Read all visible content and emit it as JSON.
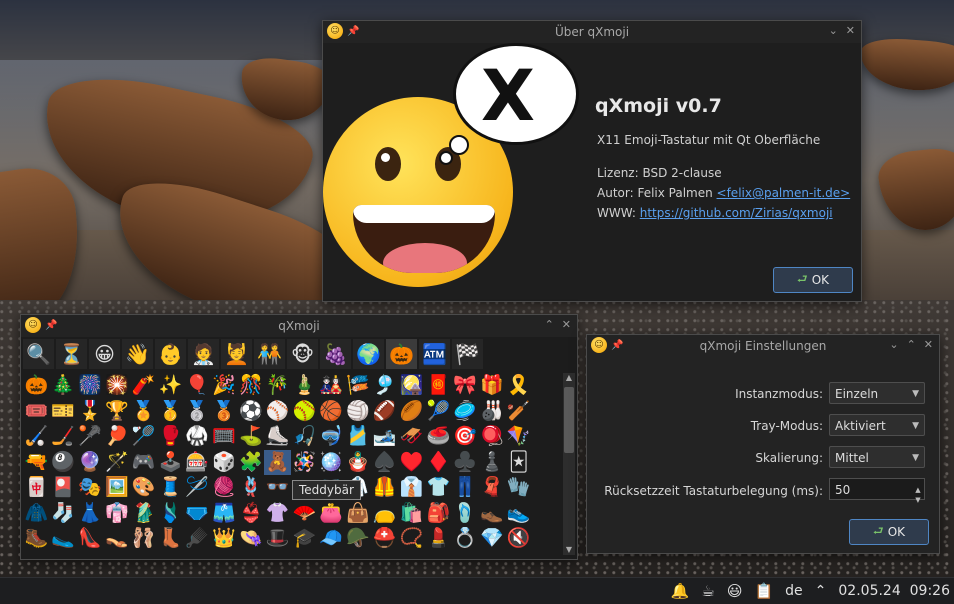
{
  "about": {
    "window_title": "Über qXmoji",
    "title": "qXmoji v0.7",
    "subtitle": "X11 Emoji-Tastatur mit Qt Oberfläche",
    "license": "Lizenz: BSD 2-clause",
    "author_prefix": "Autor:  Felix Palmen ",
    "author_email": "<felix@palmen-it.de>",
    "www_prefix": "WWW: ",
    "www_url": "https://github.com/Zirias/qxmoji",
    "ok_label": "OK"
  },
  "keyboard": {
    "window_title": "qXmoji",
    "categories": [
      "🔍",
      "⏳",
      "😀",
      "👋",
      "👶",
      "🧑‍⚕️",
      "💆",
      "🧑‍🤝‍🧑",
      "🐵",
      "🍇",
      "🌍",
      "🎃",
      "🏧",
      "🏁"
    ],
    "active_category": 11,
    "emojis": [
      "🎃",
      "🎄",
      "🎆",
      "🎇",
      "🧨",
      "✨",
      "🎈",
      "🎉",
      "🎊",
      "🎋",
      "🎍",
      "🎎",
      "🎏",
      "🎐",
      "🎑",
      "🧧",
      "🎀",
      "🎁",
      "🎗️",
      "",
      "🎟️",
      "🎫",
      "🎖️",
      "🏆",
      "🏅",
      "🥇",
      "🥈",
      "🥉",
      "⚽",
      "⚾",
      "🥎",
      "🏀",
      "🏐",
      "🏈",
      "🏉",
      "🎾",
      "🥏",
      "🎳",
      "🏏",
      "",
      "🏑",
      "🏒",
      "🥍",
      "🏓",
      "🏸",
      "🥊",
      "🥋",
      "🥅",
      "⛳",
      "⛸️",
      "🎣",
      "🤿",
      "🎽",
      "🎿",
      "🛷",
      "🥌",
      "🎯",
      "🪀",
      "🪁",
      "",
      "🔫",
      "🎱",
      "🔮",
      "🪄",
      "🎮",
      "🕹️",
      "🎰",
      "🎲",
      "🧩",
      "🧸",
      "🪅",
      "🪩",
      "🪆",
      "♠️",
      "♥️",
      "♦️",
      "♣️",
      "♟️",
      "🃏",
      "",
      "🀄",
      "🎴",
      "🎭",
      "🖼️",
      "🎨",
      "🧵",
      "🪡",
      "🧶",
      "🪢",
      "👓",
      "🕶️",
      "🥽",
      "🥼",
      "🦺",
      "👔",
      "👕",
      "👖",
      "🧣",
      "🧤",
      "",
      "🧥",
      "🧦",
      "👗",
      "👘",
      "🥻",
      "🩱",
      "🩲",
      "🩳",
      "👙",
      "👚",
      "🪭",
      "👛",
      "👜",
      "👝",
      "🛍️",
      "🎒",
      "🩴",
      "👞",
      "👟",
      "",
      "🥾",
      "🥿",
      "👠",
      "👡",
      "🩰",
      "👢",
      "🪮",
      "👑",
      "👒",
      "🎩",
      "🎓",
      "🧢",
      "🪖",
      "⛑️",
      "📿",
      "💄",
      "💍",
      "💎",
      "🔇",
      ""
    ],
    "highlighted_index": 69,
    "tooltip": "Teddybär"
  },
  "settings": {
    "window_title": "qXmoji Einstellungen",
    "fields": [
      {
        "label": "Instanzmodus:",
        "value": "Einzeln"
      },
      {
        "label": "Tray-Modus:",
        "value": "Aktiviert"
      },
      {
        "label": "Skalierung:",
        "value": "Mittel"
      }
    ],
    "delay_label": "Rücksetzzeit Tastaturbelegung (ms):",
    "delay_value": "50",
    "ok_label": "OK"
  },
  "taskbar": {
    "keyboard_layout": "de",
    "date": "02.05.24",
    "time": "09:26"
  }
}
